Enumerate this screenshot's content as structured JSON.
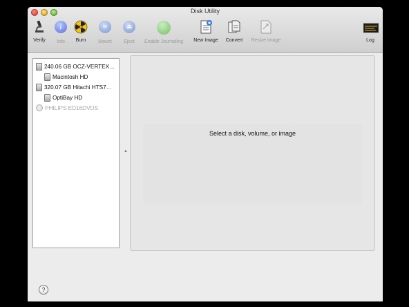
{
  "window": {
    "title": "Disk Utility"
  },
  "toolbar": {
    "items": [
      {
        "label": "Verify",
        "icon": "microscope-icon",
        "enabled": true
      },
      {
        "label": "Info",
        "icon": "info-icon",
        "enabled": false
      },
      {
        "label": "Burn",
        "icon": "burn-icon",
        "enabled": true
      },
      {
        "label": "Mount",
        "icon": "mount-icon",
        "enabled": false
      },
      {
        "label": "Eject",
        "icon": "eject-icon",
        "enabled": false
      },
      {
        "label": "Enable Journaling",
        "icon": "journaling-icon",
        "enabled": false
      },
      {
        "label": "New Image",
        "icon": "new-image-icon",
        "enabled": true
      },
      {
        "label": "Convert",
        "icon": "convert-icon",
        "enabled": true
      },
      {
        "label": "Resize Image",
        "icon": "resize-image-icon",
        "enabled": false
      },
      {
        "label": "Log",
        "icon": "log-icon",
        "enabled": true
      }
    ]
  },
  "sidebar": {
    "items": [
      {
        "label": "240.06 GB OCZ-VERTEX…",
        "type": "disk",
        "level": 0
      },
      {
        "label": "Macintosh HD",
        "type": "volume",
        "level": 1
      },
      {
        "label": "320.07 GB Hitachi HTS7…",
        "type": "disk",
        "level": 0
      },
      {
        "label": "OptiBay HD",
        "type": "volume",
        "level": 1
      },
      {
        "label": "PHILIPS ED16DVDS",
        "type": "optical",
        "level": 0,
        "dimmed": true
      }
    ]
  },
  "content": {
    "placeholder": "Select a disk, volume, or image"
  },
  "footer": {
    "help_label": "?"
  }
}
